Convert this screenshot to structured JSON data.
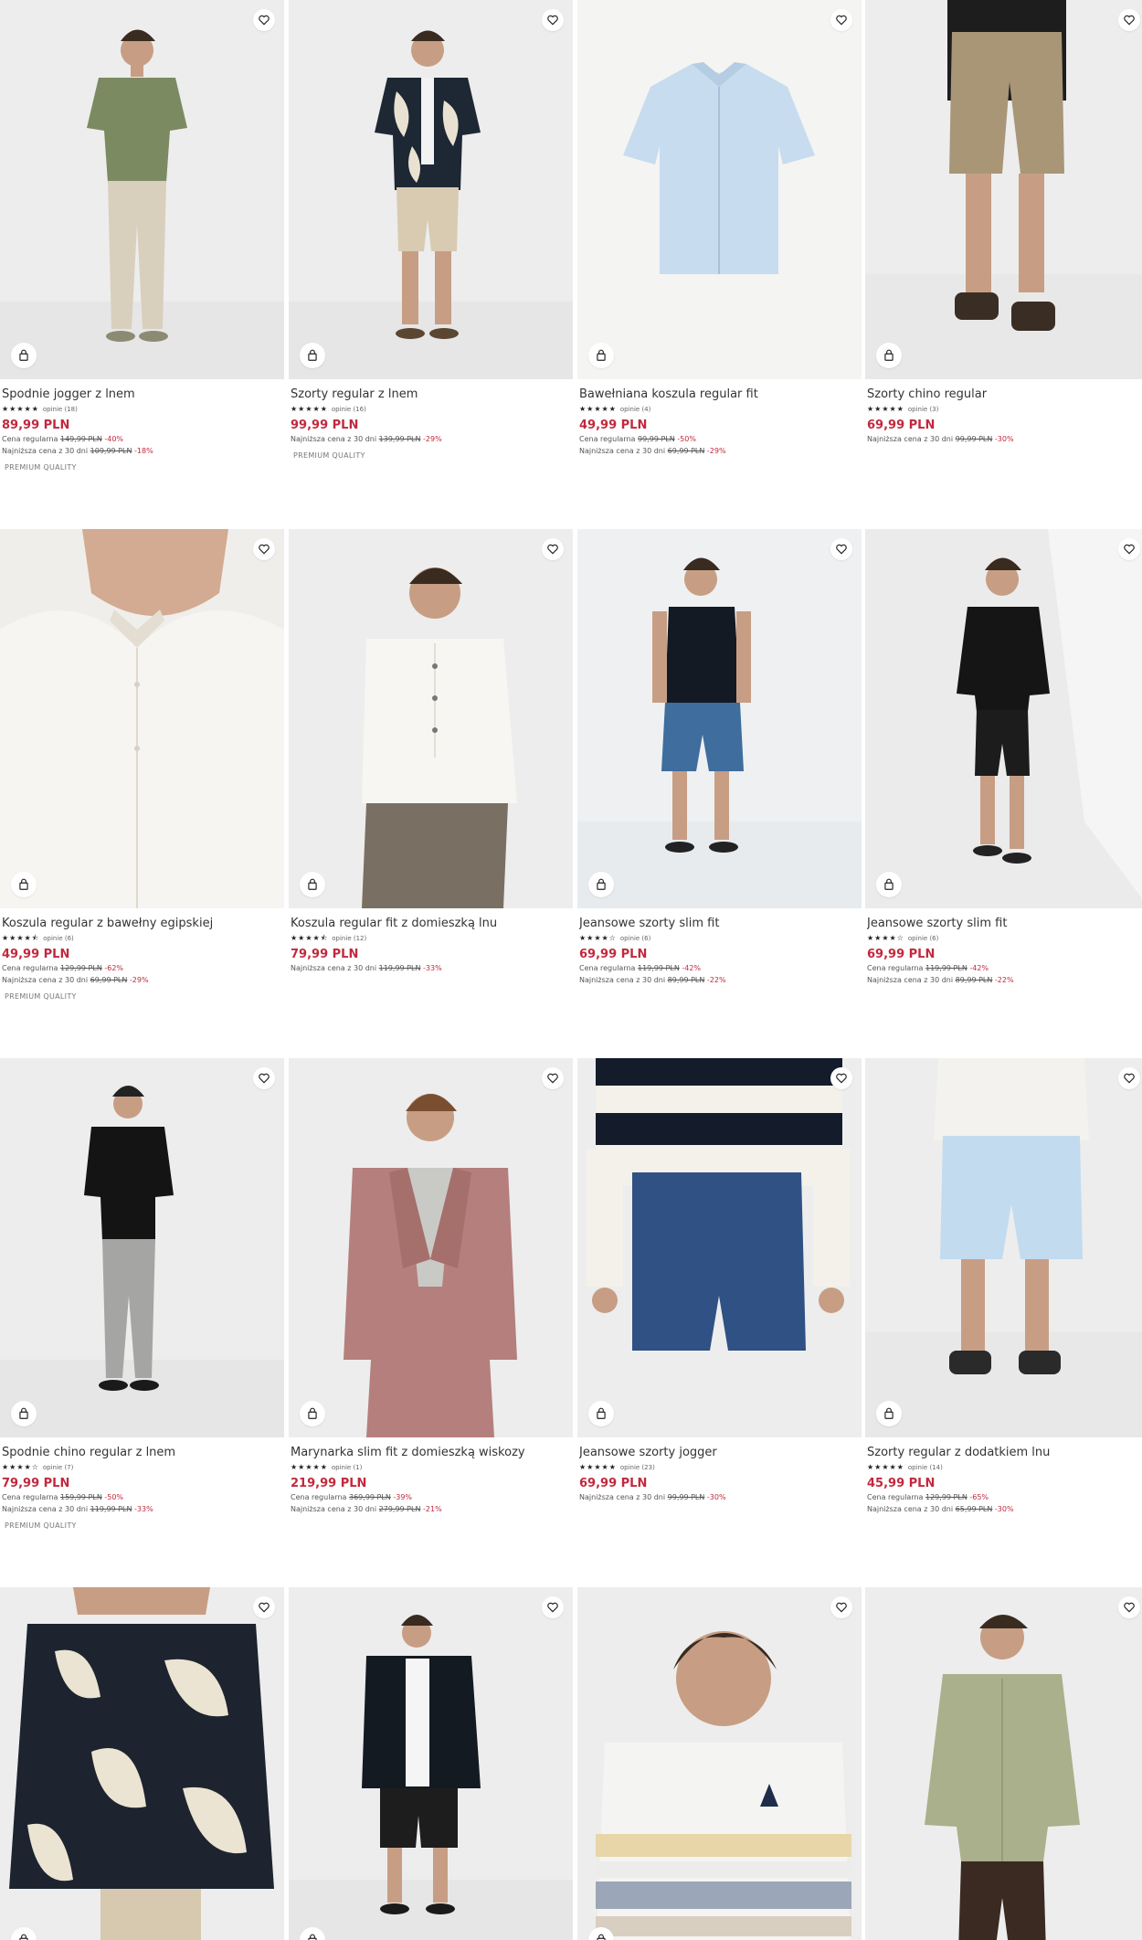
{
  "labels": {
    "regular_prefix": "Cena regularna",
    "lowest_prefix": "Najniższa cena z 30 dni"
  },
  "products": [
    {
      "name": "Spodnie jogger z lnem",
      "stars": "★★★★★",
      "reviews": "opinie (18)",
      "price": "89,99 PLN",
      "regular_price": "149,99 PLN",
      "regular_discount": "-40%",
      "lowest_price": "109,99 PLN",
      "lowest_discount": "-18%",
      "badge": "PREMIUM QUALITY"
    },
    {
      "name": "Szorty regular z lnem",
      "stars": "★★★★★",
      "reviews": "opinie (16)",
      "price": "99,99 PLN",
      "lowest_price": "139,99 PLN",
      "lowest_discount": "-29%",
      "badge": "PREMIUM QUALITY"
    },
    {
      "name": "Bawełniana koszula regular fit",
      "stars": "★★★★★",
      "reviews": "opinie (4)",
      "price": "49,99 PLN",
      "regular_price": "99,99 PLN",
      "regular_discount": "-50%",
      "lowest_price": "69,99 PLN",
      "lowest_discount": "-29%"
    },
    {
      "name": "Szorty chino regular",
      "stars": "★★★★★",
      "reviews": "opinie (3)",
      "price": "69,99 PLN",
      "lowest_price": "99,99 PLN",
      "lowest_discount": "-30%"
    },
    {
      "name": "Koszula regular z bawełny egipskiej",
      "stars": "★★★★⯪",
      "reviews": "opinie (6)",
      "price": "49,99 PLN",
      "regular_price": "129,99 PLN",
      "regular_discount": "-62%",
      "lowest_price": "69,99 PLN",
      "lowest_discount": "-29%",
      "badge": "PREMIUM QUALITY"
    },
    {
      "name": "Koszula regular fit z domieszką lnu",
      "stars": "★★★★⯪",
      "reviews": "opinie (12)",
      "price": "79,99 PLN",
      "lowest_price": "119,99 PLN",
      "lowest_discount": "-33%"
    },
    {
      "name": "Jeansowe szorty slim fit",
      "stars": "★★★★☆",
      "reviews": "opinie (6)",
      "price": "69,99 PLN",
      "regular_price": "119,99 PLN",
      "regular_discount": "-42%",
      "lowest_price": "89,99 PLN",
      "lowest_discount": "-22%"
    },
    {
      "name": "Jeansowe szorty slim fit",
      "stars": "★★★★☆",
      "reviews": "opinie (6)",
      "price": "69,99 PLN",
      "regular_price": "119,99 PLN",
      "regular_discount": "-42%",
      "lowest_price": "89,99 PLN",
      "lowest_discount": "-22%"
    },
    {
      "name": "Spodnie chino regular z lnem",
      "stars": "★★★★☆",
      "reviews": "opinie (7)",
      "price": "79,99 PLN",
      "regular_price": "159,99 PLN",
      "regular_discount": "-50%",
      "lowest_price": "119,99 PLN",
      "lowest_discount": "-33%",
      "badge": "PREMIUM QUALITY"
    },
    {
      "name": "Marynarka slim fit z domieszką wiskozy",
      "stars": "★★★★★",
      "reviews": "opinie (1)",
      "price": "219,99 PLN",
      "regular_price": "369,99 PLN",
      "regular_discount": "-39%",
      "lowest_price": "279,99 PLN",
      "lowest_discount": "-21%"
    },
    {
      "name": "Jeansowe szorty jogger",
      "stars": "★★★★★",
      "reviews": "opinie (23)",
      "price": "69,99 PLN",
      "lowest_price": "99,99 PLN",
      "lowest_discount": "-30%"
    },
    {
      "name": "Szorty regular z dodatkiem lnu",
      "stars": "★★★★★",
      "reviews": "opinie (14)",
      "price": "45,99 PLN",
      "regular_price": "129,99 PLN",
      "regular_discount": "-65%",
      "lowest_price": "65,99 PLN",
      "lowest_discount": "-30%"
    },
    {
      "name": "",
      "stars": "",
      "reviews": "",
      "price": ""
    },
    {
      "name": "",
      "stars": "",
      "reviews": "",
      "price": ""
    },
    {
      "name": "",
      "stars": "",
      "reviews": "",
      "price": ""
    },
    {
      "name": "",
      "stars": "",
      "reviews": "",
      "price": ""
    }
  ],
  "icons": {
    "favorite": "heart-outline-icon",
    "cart": "shopping-bag-icon"
  },
  "colors": {
    "price": "#c1293d",
    "discount": "#c1293d",
    "text": "#2b2b2b",
    "image_bg": "#ededed"
  }
}
